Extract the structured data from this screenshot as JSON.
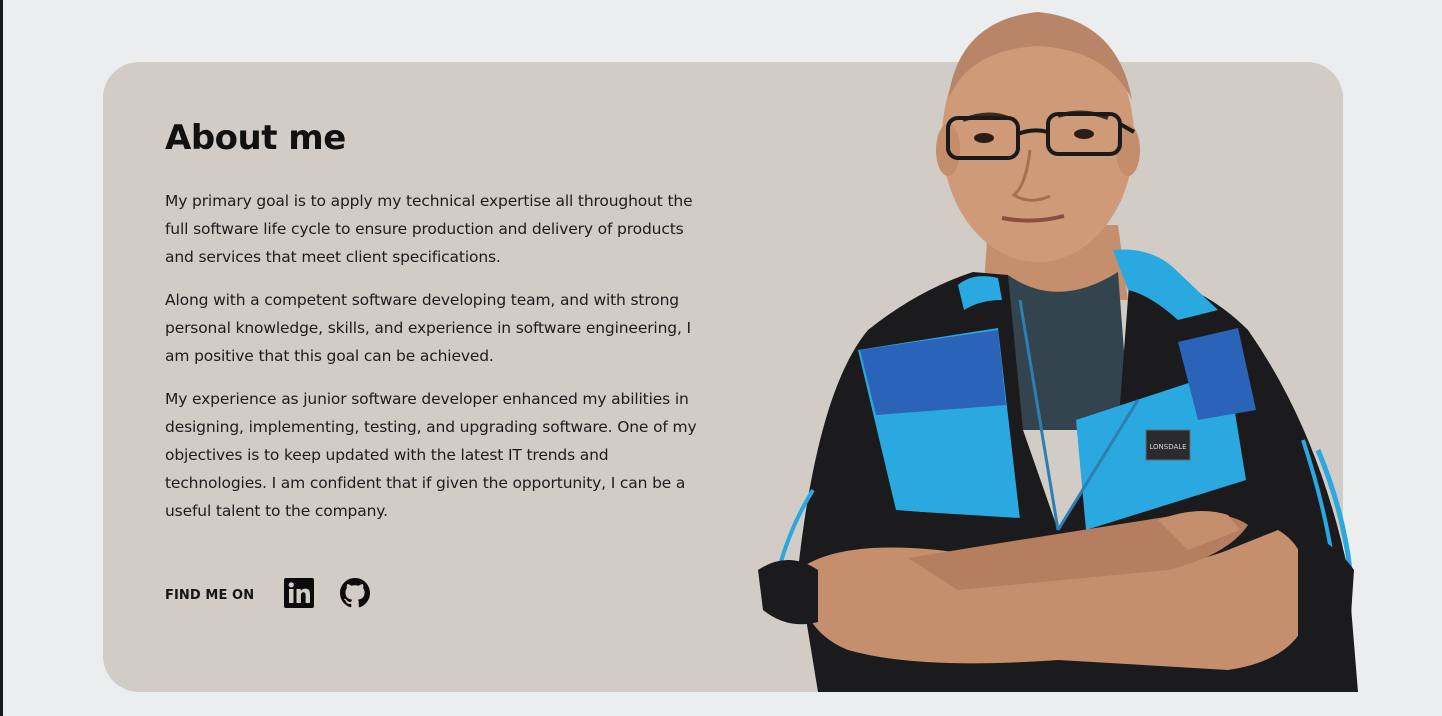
{
  "about": {
    "title": "About me",
    "paragraphs": [
      "My primary goal is to apply my technical expertise all throughout the full software life cycle to ensure production and delivery of products and services that meet client specifications.",
      "Along with a competent software developing team, and with strong personal knowledge, skills, and experience in software engineering, I am positive that this goal can be achieved.",
      "My experience as junior software developer enhanced my abilities in designing, implementing, testing, and upgrading software. One of my objectives is to keep updated with the latest IT trends and technologies. I am confident that if given the opportunity, I can be a useful talent to the company."
    ]
  },
  "social": {
    "label": "FIND ME ON",
    "links": [
      {
        "icon": "linkedin-icon"
      },
      {
        "icon": "github-icon"
      }
    ]
  },
  "portrait": {
    "jacket_badge": "LONSDALE"
  },
  "colors": {
    "page_bg": "#ecedef",
    "card_bg": "#d1ccc6",
    "text": "#1c1c1c",
    "jacket_blue": "#2aa8e0",
    "jacket_dark": "#1b1b1d"
  }
}
